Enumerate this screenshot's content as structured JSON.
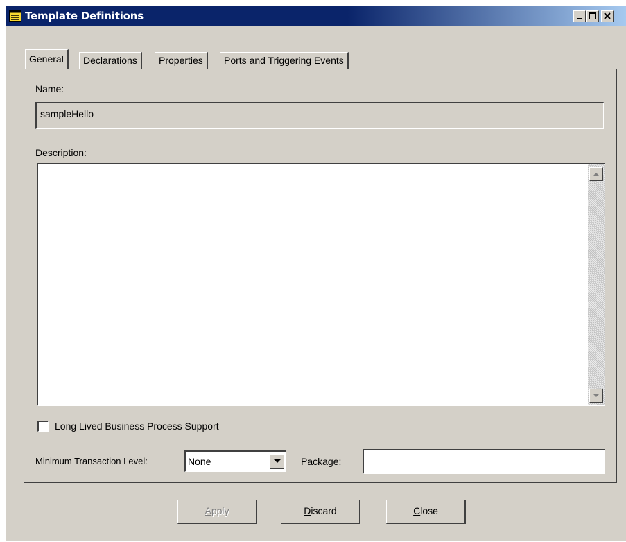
{
  "window": {
    "title": "Template Definitions",
    "controls": [
      "minimize-icon",
      "maximize-icon",
      "close-icon"
    ]
  },
  "tabs": [
    {
      "label": "General",
      "active": true
    },
    {
      "label": "Declarations",
      "active": false
    },
    {
      "label": "Properties",
      "active": false
    },
    {
      "label": "Ports and Triggering Events",
      "active": false
    }
  ],
  "general": {
    "name_label": "Name:",
    "name_value": "sampleHello",
    "description_label": "Description:",
    "description_value": "",
    "long_lived": {
      "label": "Long Lived Business Process Support",
      "checked": false
    },
    "min_txn_label": "Minimum Transaction Level:",
    "min_txn_value": "None",
    "package_label": "Package:",
    "package_value": ""
  },
  "buttons": {
    "apply": {
      "accel": "A",
      "rest": "pply",
      "enabled": false
    },
    "discard": {
      "accel": "D",
      "rest": "iscard",
      "enabled": true
    },
    "close": {
      "accel": "C",
      "rest": "lose",
      "enabled": true
    }
  },
  "colors": {
    "titlebar": "#0a246a",
    "face": "#d4d0c8",
    "app_icon": "#f8d830"
  }
}
